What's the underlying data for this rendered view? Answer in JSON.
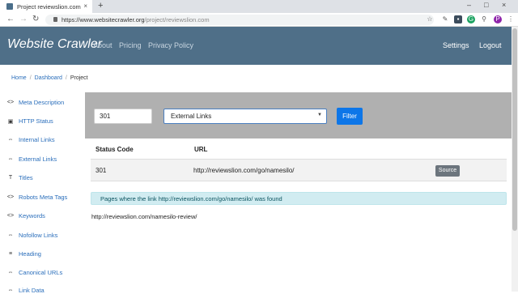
{
  "browser": {
    "tab_title": "Project reviewslion.com",
    "tab_close": "×",
    "new_tab": "+",
    "url_prefix": "https://www.websitecrawler.org",
    "url_path": "/project/reviewslion.com",
    "avatar_letter": "P",
    "window_controls": [
      "–",
      "□",
      "×"
    ]
  },
  "navbar": {
    "brand": "Website Crawler",
    "links": [
      "About",
      "Pricing",
      "Privacy Policy"
    ],
    "right": [
      "Settings",
      "Logout"
    ]
  },
  "breadcrumb": [
    "Home",
    "Dashboard",
    "Project"
  ],
  "sidebar": {
    "items": [
      {
        "icon": "<>",
        "label": "Meta Description"
      },
      {
        "icon": "▣",
        "label": "HTTP Status"
      },
      {
        "icon": "⇔",
        "label": "Internal Links"
      },
      {
        "icon": "⇔",
        "label": "External Links"
      },
      {
        "icon": "T",
        "label": "Titles"
      },
      {
        "icon": "<>",
        "label": "Robots Meta Tags"
      },
      {
        "icon": "<>",
        "label": "Keywords"
      },
      {
        "icon": "⇔",
        "label": "Nofollow Links"
      },
      {
        "icon": "≡",
        "label": "Heading"
      },
      {
        "icon": "⇔",
        "label": "Canonical URLs"
      },
      {
        "icon": "⇔",
        "label": "Link Data"
      }
    ]
  },
  "filter": {
    "input_value": "301",
    "select_value": "External Links",
    "button": "Filter"
  },
  "table": {
    "headers": [
      "Status Code",
      "URL"
    ],
    "rows": [
      {
        "status": "301",
        "url": "http://reviewslion.com/go/namesilo/",
        "action": "Source"
      }
    ]
  },
  "alert": "Pages where the link http://reviewslion.com/go/namesilo/ was found",
  "result_url": "http://reviewslion.com/namesilo-review/"
}
